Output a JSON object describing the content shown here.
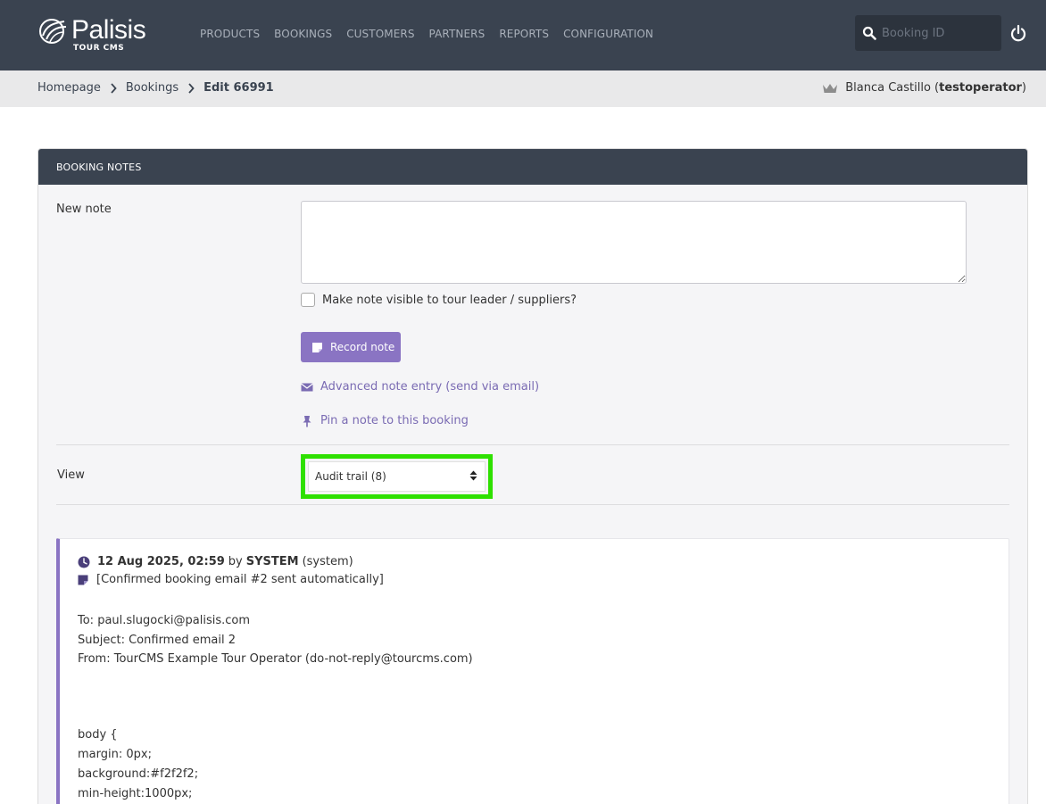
{
  "brand": {
    "name": "Palisis",
    "sub": "TOUR CMS"
  },
  "nav": [
    "PRODUCTS",
    "BOOKINGS",
    "CUSTOMERS",
    "PARTNERS",
    "REPORTS",
    "CONFIGURATION"
  ],
  "search": {
    "placeholder": "Booking ID"
  },
  "breadcrumb": {
    "home": "Homepage",
    "bookings": "Bookings",
    "current": "Edit 66991"
  },
  "user": {
    "name": "Blanca Castillo",
    "username": "testoperator"
  },
  "panel": {
    "title": "BOOKING NOTES"
  },
  "form": {
    "new_note_label": "New note",
    "checkbox_label": "Make note visible to tour leader / suppliers?",
    "record_button": "Record note",
    "advanced_link": "Advanced note entry (send via email)",
    "pin_link": "Pin a note to this booking",
    "view_label": "View",
    "view_value": "Audit trail (8)"
  },
  "audit": {
    "date": "12 Aug 2025, 02:59",
    "by": "by",
    "user": "SYSTEM",
    "role": "(system)",
    "subject": "[Confirmed booking email #2 sent automatically]",
    "lines": [
      "To: paul.slugocki@palisis.com",
      "Subject: Confirmed email 2",
      "From: TourCMS Example Tour Operator (do-not-reply@tourcms.com)"
    ],
    "code": [
      "body {",
      "margin: 0px;",
      "background:#f2f2f2;",
      "min-height:1000px;"
    ]
  },
  "colors": {
    "header": "#3a4350",
    "accent": "#8a74c3",
    "highlight": "#2ee000"
  }
}
